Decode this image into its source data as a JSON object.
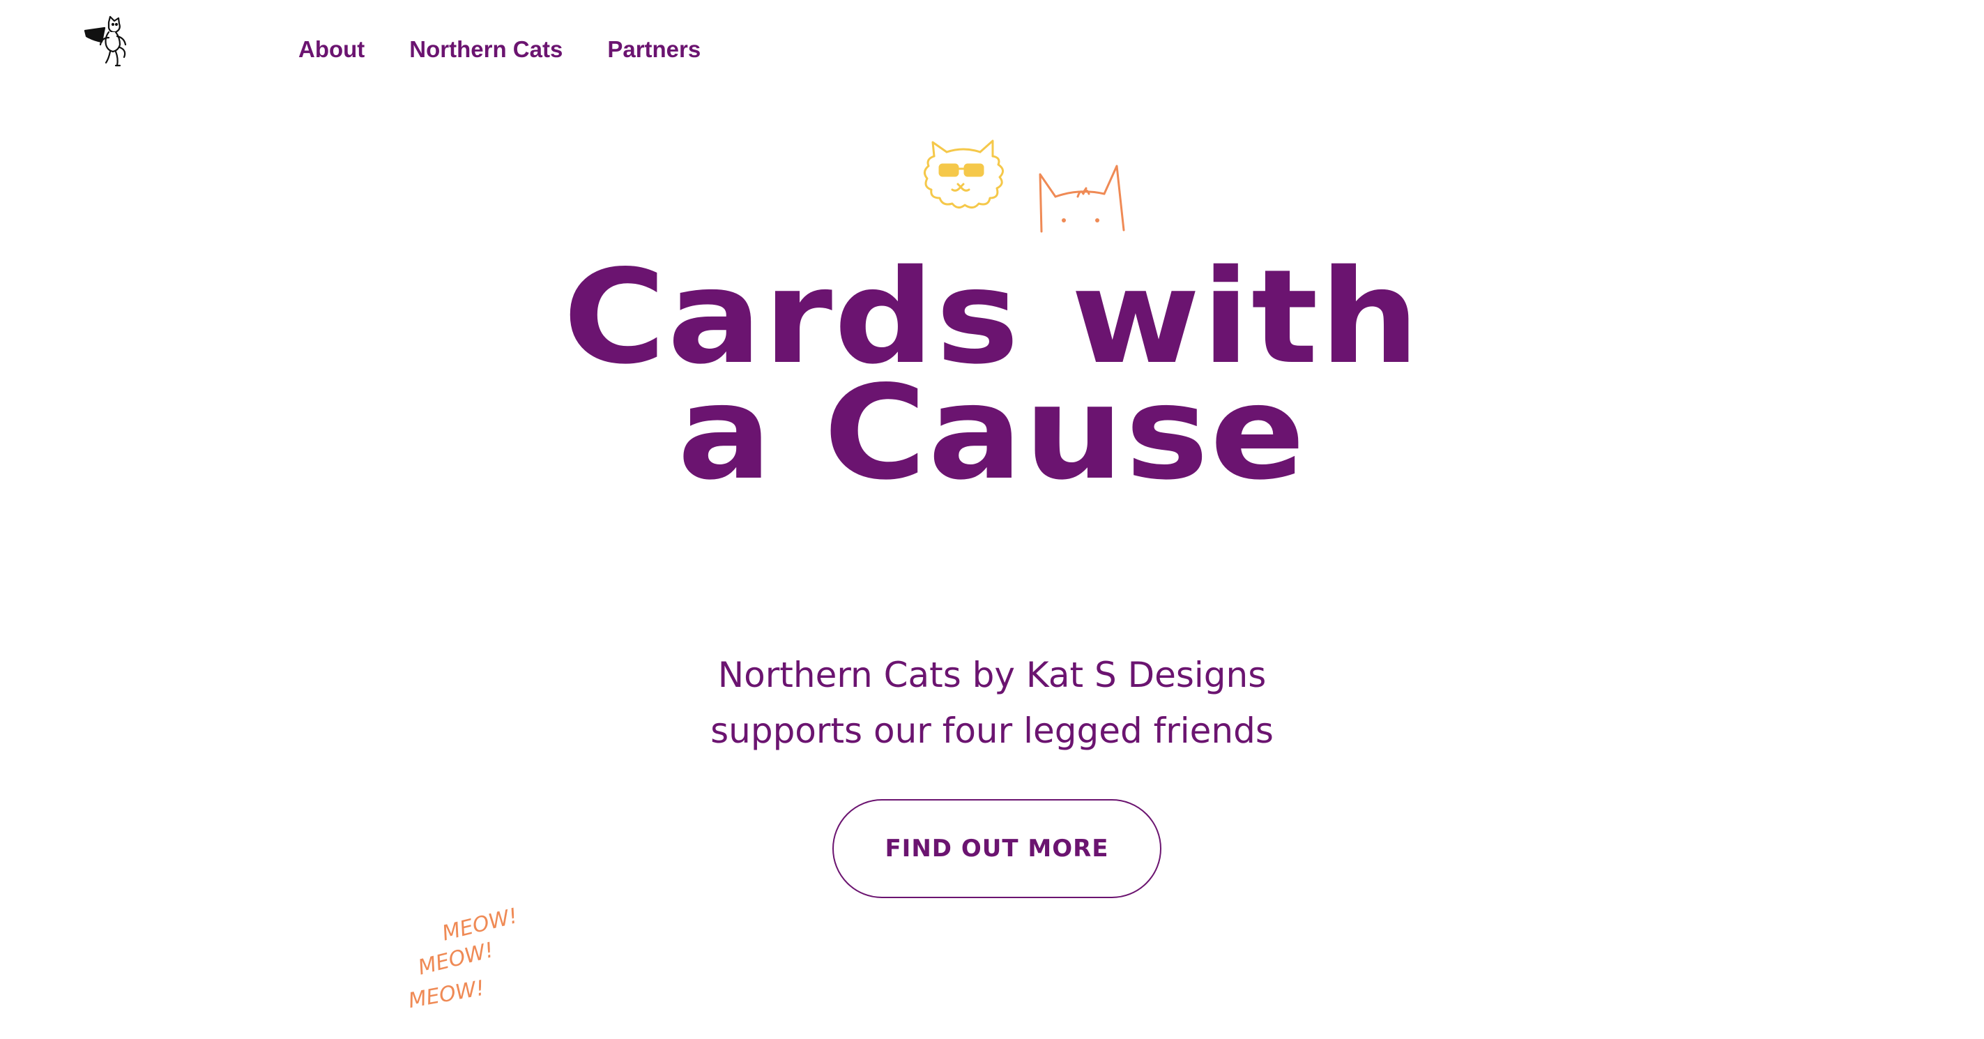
{
  "nav": {
    "items": [
      {
        "label": "About"
      },
      {
        "label": "Northern Cats"
      },
      {
        "label": "Partners"
      }
    ]
  },
  "hero": {
    "title_line1": "Cards with",
    "title_line2": "a Cause",
    "subtitle_line1": "Northern Cats by Kat S Designs",
    "subtitle_line2": "supports our four legged friends",
    "cta_label": "FIND OUT MORE"
  },
  "doodles": {
    "meow_text": "MEOW!"
  },
  "colors": {
    "brand_purple": "#6b1470",
    "doodle_yellow": "#f5c84a",
    "doodle_orange": "#ef8a55",
    "background": "#ffffff"
  },
  "icons": {
    "logo": "superhero-cat-logo",
    "doodle_left": "sunglasses-cat-icon",
    "doodle_right": "cat-ears-icon"
  }
}
